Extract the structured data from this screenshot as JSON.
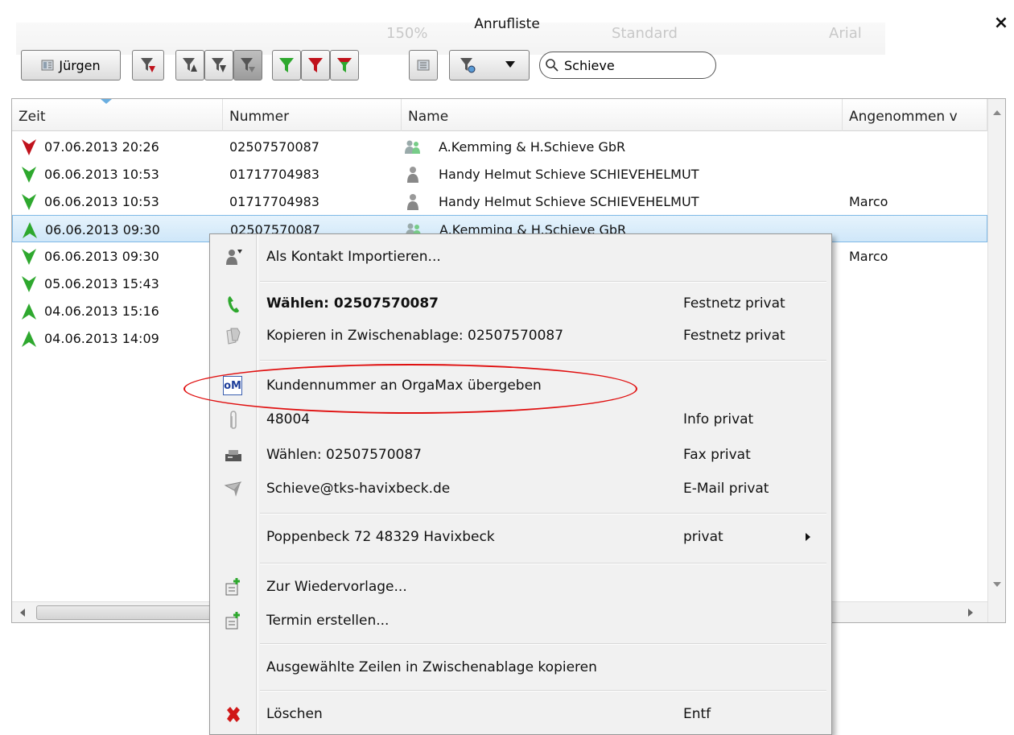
{
  "window": {
    "title": "Anrufliste",
    "close_glyph": "×"
  },
  "background_ghost": {
    "zoom": "150%",
    "style": "Standard",
    "font": "Arial 11,5",
    "font2": "Arial"
  },
  "toolbar": {
    "user_button": "Jürgen",
    "search_value": "Schieve"
  },
  "table": {
    "columns": [
      "Zeit",
      "Nummer",
      "Name",
      "Angenommen v"
    ],
    "rows": [
      {
        "direction": "missed",
        "time": "07.06.2013 20:26",
        "number": "02507570087",
        "contact_icon": "group-contact-icon",
        "name": "A.Kemming & H.Schieve GbR",
        "accepted": ""
      },
      {
        "direction": "incoming",
        "time": "06.06.2013 10:53",
        "number": "01717704983",
        "contact_icon": "person-contact-icon",
        "name": "Handy Helmut Schieve SCHIEVEHELMUT",
        "accepted": ""
      },
      {
        "direction": "incoming",
        "time": "06.06.2013 10:53",
        "number": "01717704983",
        "contact_icon": "person-contact-icon",
        "name": "Handy Helmut Schieve SCHIEVEHELMUT",
        "accepted": "Marco"
      },
      {
        "direction": "outgoing",
        "time": "06.06.2013 09:30",
        "number": "02507570087",
        "contact_icon": "group-contact-icon",
        "name": "A.Kemming & H.Schieve GbR",
        "accepted": "",
        "selected": true
      },
      {
        "direction": "incoming",
        "time": "06.06.2013 09:30",
        "number": "",
        "contact_icon": "",
        "name": "",
        "accepted": "Marco"
      },
      {
        "direction": "incoming",
        "time": "05.06.2013 15:43",
        "number": "",
        "contact_icon": "",
        "name": "",
        "accepted": ""
      },
      {
        "direction": "outgoing",
        "time": "04.06.2013 15:16",
        "number": "",
        "contact_icon": "",
        "name": "",
        "accepted": ""
      },
      {
        "direction": "outgoing",
        "time": "04.06.2013 14:09",
        "number": "",
        "contact_icon": "",
        "name": "",
        "accepted": ""
      }
    ]
  },
  "context_menu": {
    "items": [
      {
        "icon": "import-contact-icon",
        "label": "Als Kontakt Importieren...",
        "shortcut": ""
      },
      {
        "icon": "phone-handset-icon",
        "label": "Wählen: 02507570087",
        "shortcut": "Festnetz privat",
        "bold": true
      },
      {
        "icon": "copy-clipboard-icon",
        "label": "Kopieren in Zwischenablage: 02507570087",
        "shortcut": "Festnetz privat"
      },
      {
        "icon": "orgamax-icon",
        "icon_text": "oM",
        "label": "Kundennummer an OrgaMax übergeben",
        "shortcut": ""
      },
      {
        "icon": "paperclip-icon",
        "label": "48004",
        "shortcut": "Info privat"
      },
      {
        "icon": "fax-icon",
        "label": "Wählen: 02507570087",
        "shortcut": "Fax privat"
      },
      {
        "icon": "email-icon",
        "label": "Schieve@tks-havixbeck.de",
        "shortcut": "E-Mail privat"
      },
      {
        "icon": "",
        "label": "Poppenbeck 72 48329 Havixbeck",
        "shortcut": "privat"
      },
      {
        "icon": "reminder-icon",
        "label": "Zur Wiedervorlage...",
        "shortcut": ""
      },
      {
        "icon": "appointment-icon",
        "label": "Termin erstellen...",
        "shortcut": ""
      },
      {
        "icon": "",
        "label": "Ausgewählte Zeilen in Zwischenablage kopieren",
        "shortcut": ""
      },
      {
        "icon": "delete-x-icon",
        "label": "Löschen",
        "shortcut": "Entf"
      }
    ]
  },
  "colors": {
    "missed": "#c0121c",
    "incoming": "#2ea82e",
    "outgoing": "#2ea82e",
    "selection": "#cfe7f9",
    "highlight_ellipse": "#e01010"
  }
}
